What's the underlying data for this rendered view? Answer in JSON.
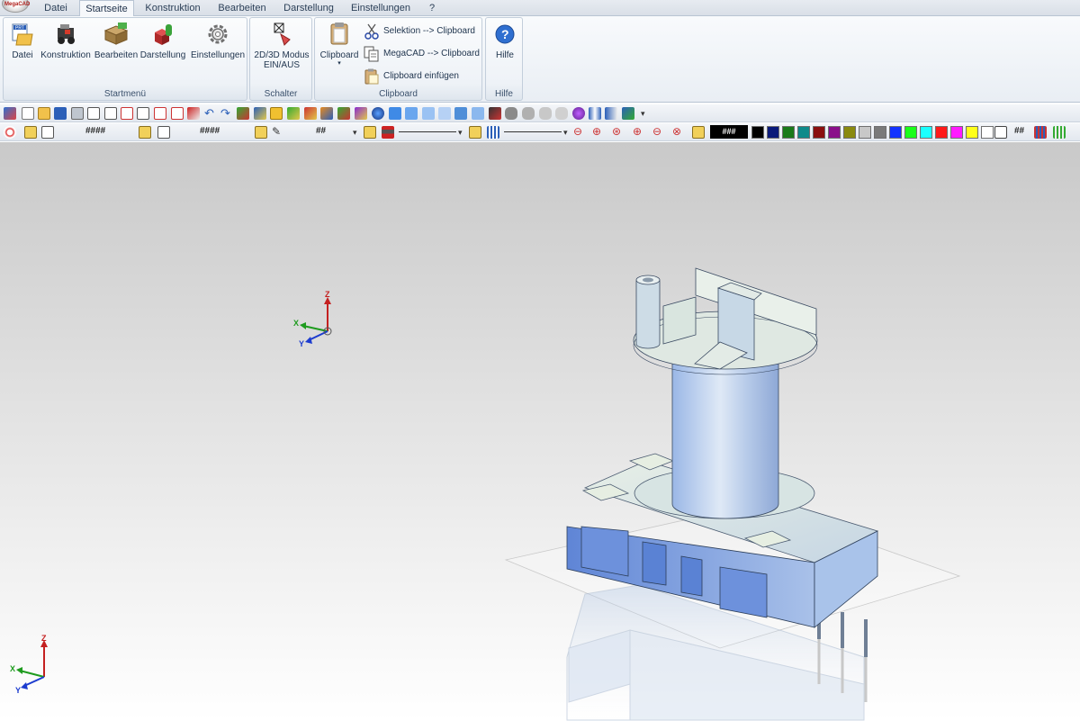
{
  "menu_tabs": [
    {
      "label": "Datei"
    },
    {
      "label": "Startseite",
      "active": true
    },
    {
      "label": "Konstruktion"
    },
    {
      "label": "Bearbeiten"
    },
    {
      "label": "Darstellung"
    },
    {
      "label": "Einstellungen"
    },
    {
      "label": "?"
    }
  ],
  "app_logo_text": "MegaCAD",
  "ribbon": {
    "startmenu": {
      "label": "Startmenü",
      "buttons": [
        "Datei",
        "Konstruktion",
        "Bearbeiten",
        "Darstellung",
        "Einstellungen"
      ]
    },
    "schalter": {
      "label": "Schalter",
      "button_line1": "2D/3D Modus",
      "button_line2": "EIN/AUS"
    },
    "clipboard": {
      "label": "Clipboard",
      "big_button": "Clipboard",
      "selection_to_clipboard": "Selektion --> Clipboard",
      "megacad_to_clipboard": "MegaCAD --> Clipboard",
      "paste_clipboard": "Clipboard einfügen"
    },
    "hilfe": {
      "label": "Hilfe",
      "button": "Hilfe"
    }
  },
  "toolbar2": {
    "field1": "####",
    "field2": "####",
    "field3": "##",
    "color_field": "###",
    "hash_label": "##",
    "colors": [
      "#000000",
      "#0a1a7a",
      "#1a7a1a",
      "#0f8a8a",
      "#8a0f0f",
      "#8a0f8a",
      "#8a8a0f",
      "#c8c8c8",
      "#7a7a7a",
      "#1433ff",
      "#1aff1a",
      "#1affff",
      "#ff1a1a",
      "#ff1aff",
      "#ffff1a",
      "#ffffff"
    ]
  },
  "viewport": {
    "axis_labels": {
      "z": "Z",
      "x": "X",
      "y": "Y"
    },
    "axis_colors": {
      "z": "#c42020",
      "x": "#1e9b1e",
      "y": "#1c3ccf"
    }
  }
}
